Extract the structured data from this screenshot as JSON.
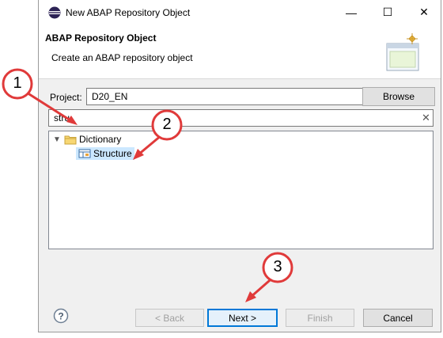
{
  "window": {
    "title": "New ABAP Repository Object",
    "minimize": "—",
    "maximize": "☐",
    "close": "✕"
  },
  "banner": {
    "title": "ABAP Repository Object",
    "description": "Create an ABAP repository object"
  },
  "project": {
    "label": "Project:",
    "value": "D20_EN",
    "browse_label": "Browse"
  },
  "filter": {
    "value": "stru"
  },
  "tree": {
    "folder_label": "Dictionary",
    "item_label": "Structure"
  },
  "buttons": {
    "back": "< Back",
    "next": "Next >",
    "finish": "Finish",
    "cancel": "Cancel"
  },
  "callouts": [
    "1",
    "2",
    "3"
  ],
  "colors": {
    "callout_red": "#e03a3a",
    "selection": "#cce8ff",
    "default_button_border": "#0078d7"
  }
}
